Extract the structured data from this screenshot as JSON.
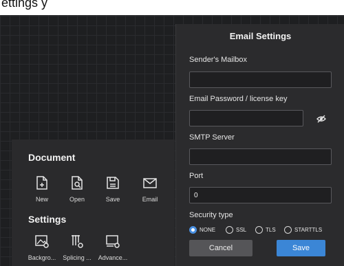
{
  "top_bar": {
    "title": "ettings y"
  },
  "document_section": {
    "title": "Document",
    "tools": [
      {
        "label": "New",
        "icon": "new-file-icon"
      },
      {
        "label": "Open",
        "icon": "open-file-icon"
      },
      {
        "label": "Save",
        "icon": "save-icon"
      },
      {
        "label": "Email",
        "icon": "email-icon"
      }
    ]
  },
  "settings_section": {
    "title": "Settings",
    "tools": [
      {
        "label": "Backgro...",
        "icon": "background-settings-icon"
      },
      {
        "label": "Splicing ...",
        "icon": "splicing-settings-icon"
      },
      {
        "label": "Advance...",
        "icon": "advanced-settings-icon"
      }
    ]
  },
  "email_dialog": {
    "title": "Email Settings",
    "sender_label": "Sender's Mailbox",
    "sender_value": "",
    "password_label": "Email Password / license key",
    "password_value": "",
    "smtp_label": "SMTP Server",
    "smtp_value": "",
    "port_label": "Port",
    "port_value": "0",
    "security_label": "Security type",
    "security_options": [
      "NONE",
      "SSL",
      "TLS",
      "STARTTLS"
    ],
    "security_selected": "NONE",
    "cancel_label": "Cancel",
    "save_label": "Save"
  },
  "colors": {
    "accent": "#3b86d6",
    "panel": "#2a2a2c",
    "canvas": "#1e1f21"
  }
}
